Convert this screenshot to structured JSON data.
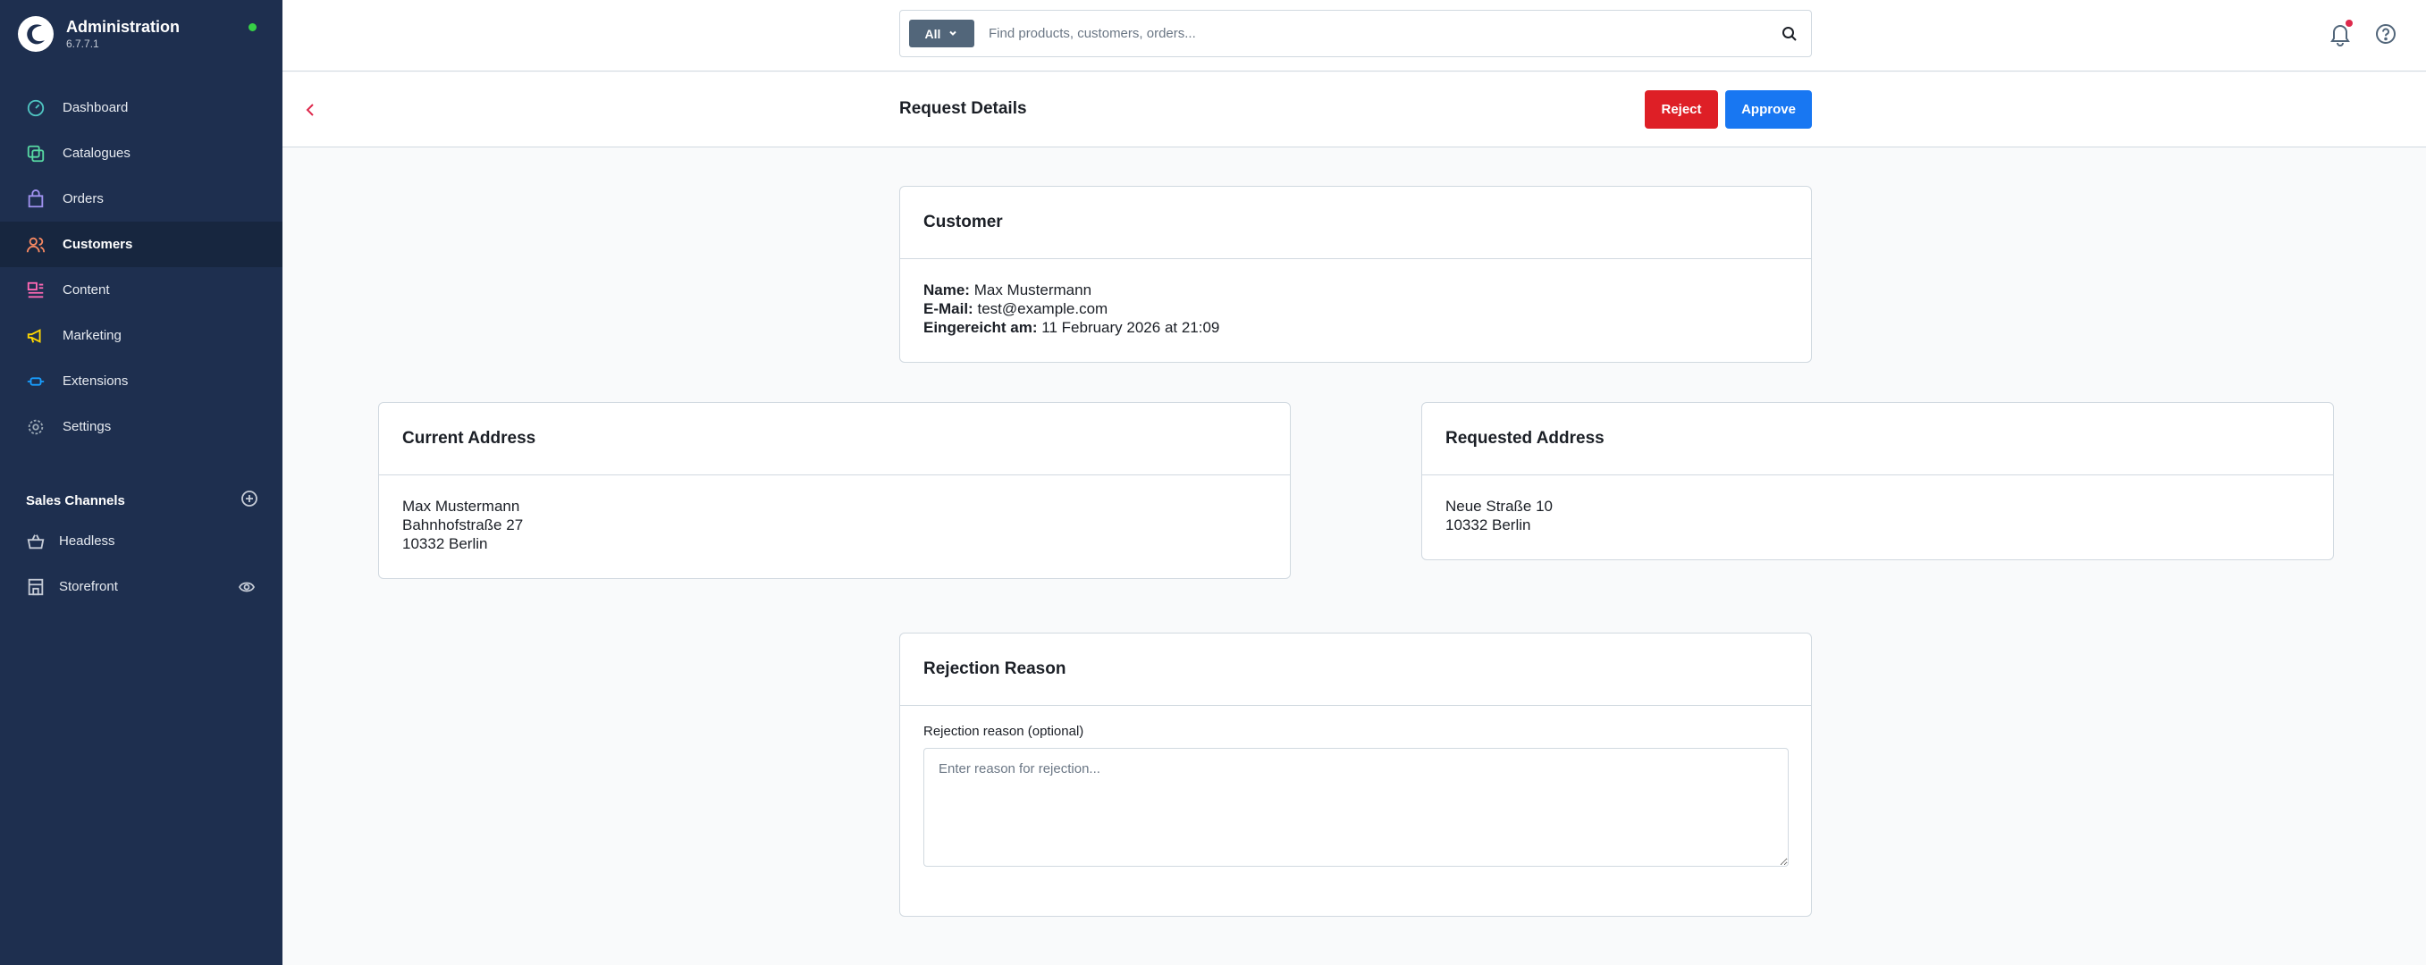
{
  "app": {
    "title": "Administration",
    "version": "6.7.7.1"
  },
  "colors": {
    "sidebar_bg": "#1e2f4f",
    "active_bg": "#17263f",
    "reject": "#de1f26",
    "approve": "#1877f2",
    "status_dot": "#37d046"
  },
  "sidebar": {
    "items": [
      {
        "label": "Dashboard",
        "icon": "dashboard-icon",
        "color": "#4fc4c1"
      },
      {
        "label": "Catalogues",
        "icon": "catalogues-icon",
        "color": "#57d9a3"
      },
      {
        "label": "Orders",
        "icon": "orders-icon",
        "color": "#a092f0"
      },
      {
        "label": "Customers",
        "icon": "customers-icon",
        "color": "#f88962",
        "active": true
      },
      {
        "label": "Content",
        "icon": "content-icon",
        "color": "#ff68b4"
      },
      {
        "label": "Marketing",
        "icon": "marketing-icon",
        "color": "#ffd700"
      },
      {
        "label": "Extensions",
        "icon": "extensions-icon",
        "color": "#189eff"
      },
      {
        "label": "Settings",
        "icon": "settings-icon",
        "color": "#9aa8b5"
      }
    ],
    "sales_channels": {
      "title": "Sales Channels",
      "items": [
        {
          "label": "Headless",
          "icon": "basket-icon"
        },
        {
          "label": "Storefront",
          "icon": "storefront-icon"
        }
      ]
    }
  },
  "search": {
    "filter_label": "All",
    "placeholder": "Find products, customers, orders..."
  },
  "header": {
    "title": "Request Details",
    "reject_label": "Reject",
    "approve_label": "Approve"
  },
  "customer_card": {
    "title": "Customer",
    "name_label": "Name:",
    "name_value": "Max Mustermann",
    "email_label": "E-Mail:",
    "email_value": "test@example.com",
    "submitted_label": "Eingereicht am:",
    "submitted_value": "11 February 2026 at 21:09"
  },
  "current_address": {
    "title": "Current Address",
    "lines": [
      "Max Mustermann",
      "Bahnhofstraße 27",
      "10332 Berlin"
    ]
  },
  "requested_address": {
    "title": "Requested Address",
    "lines": [
      "Neue Straße 10",
      "10332 Berlin"
    ]
  },
  "rejection": {
    "title": "Rejection Reason",
    "field_label": "Rejection reason (optional)",
    "placeholder": "Enter reason for rejection..."
  }
}
